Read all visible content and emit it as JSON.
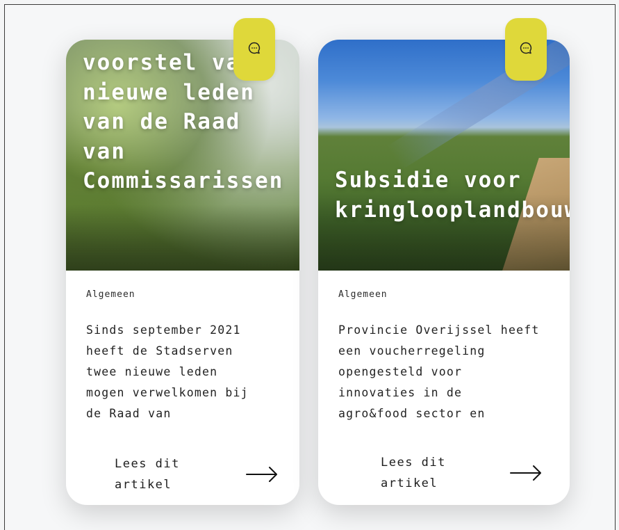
{
  "cards": [
    {
      "title": "voorstel van\nnieuwe leden\nvan de Raad\nvan\nCommissarissen",
      "category": "Algemeen",
      "excerpt": "Sinds september 2021\nheeft de Stadserven\ntwee nieuwe leden\nmogen verwelkomen bij\nde Raad van",
      "read_more": "Lees dit artikel",
      "badge_icon": "chat-bubble-icon"
    },
    {
      "title": "Subsidie voor\nkringlooplandbouw",
      "category": "Algemeen",
      "excerpt": "Provincie Overijssel heeft\neen voucherregeling\nopengesteld voor\ninnovaties in de\nagro&food sector en",
      "read_more": "Lees dit artikel",
      "badge_icon": "chat-bubble-icon"
    }
  ],
  "colors": {
    "badge": "#dfd83a",
    "card_background": "#ffffff",
    "text": "#222222"
  }
}
